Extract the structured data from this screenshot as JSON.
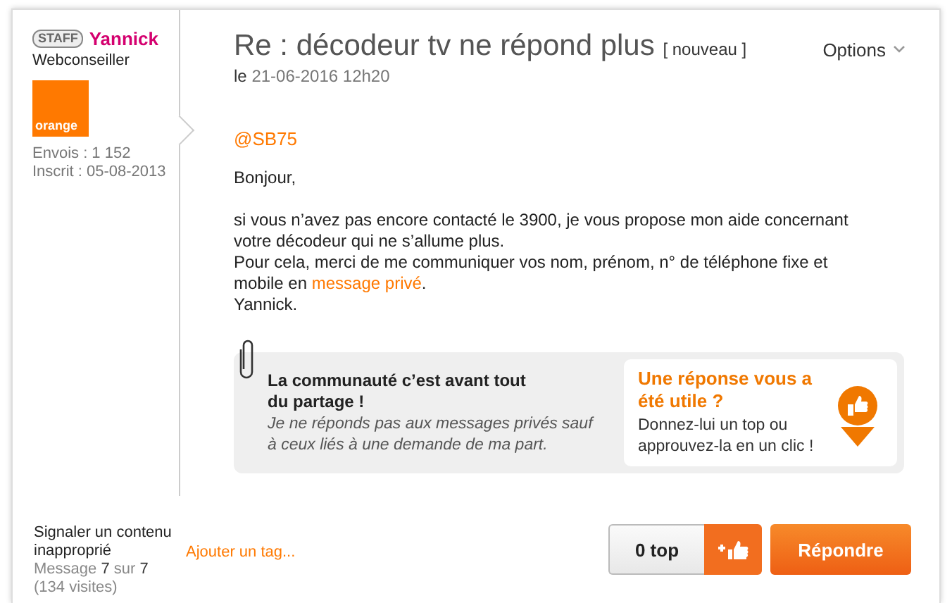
{
  "author": {
    "badge": "STAFF",
    "name": "Yannick",
    "role": "Webconseiller",
    "logo": "orange",
    "stats": [
      "Envois : 1 152",
      "Inscrit : 05-08-2013"
    ]
  },
  "post": {
    "title": "Re : décodeur tv ne répond plus",
    "tag": "[ nouveau ]",
    "date_prefix": "le",
    "date": "21-06-2016 12h20",
    "options": "Options",
    "mention": "@SB75",
    "greeting": "Bonjour,",
    "lines": [
      {
        "text": "si vous n’avez pas encore contacté le 3900, je vous propose mon aide concernant"
      },
      {
        "text": "votre décodeur qui ne s’allume plus."
      },
      {
        "text": "Pour cela, merci de me communiquer vos nom, prénom, n° de téléphone fixe et"
      },
      {
        "text": "mobile en",
        "link": "message privé",
        "after": "."
      },
      {
        "text": "Yannick."
      }
    ]
  },
  "notice": {
    "heading": "La communauté c’est avant tout du partage !",
    "note": "Je ne réponds pas aux messages privés sauf à ceux liés à une demande de ma part.",
    "prompt": "Une réponse vous a été utile ?",
    "hint": "Donnez-lui un top ou approuvez-la en un clic !"
  },
  "footer": {
    "report": "Signaler un contenu inapproprié",
    "message_info": "Message **7** sur **7**",
    "visits": "(134 visites)",
    "add_tag": "Ajouter un tag...",
    "tops": "0 top",
    "reply": "Répondre"
  }
}
